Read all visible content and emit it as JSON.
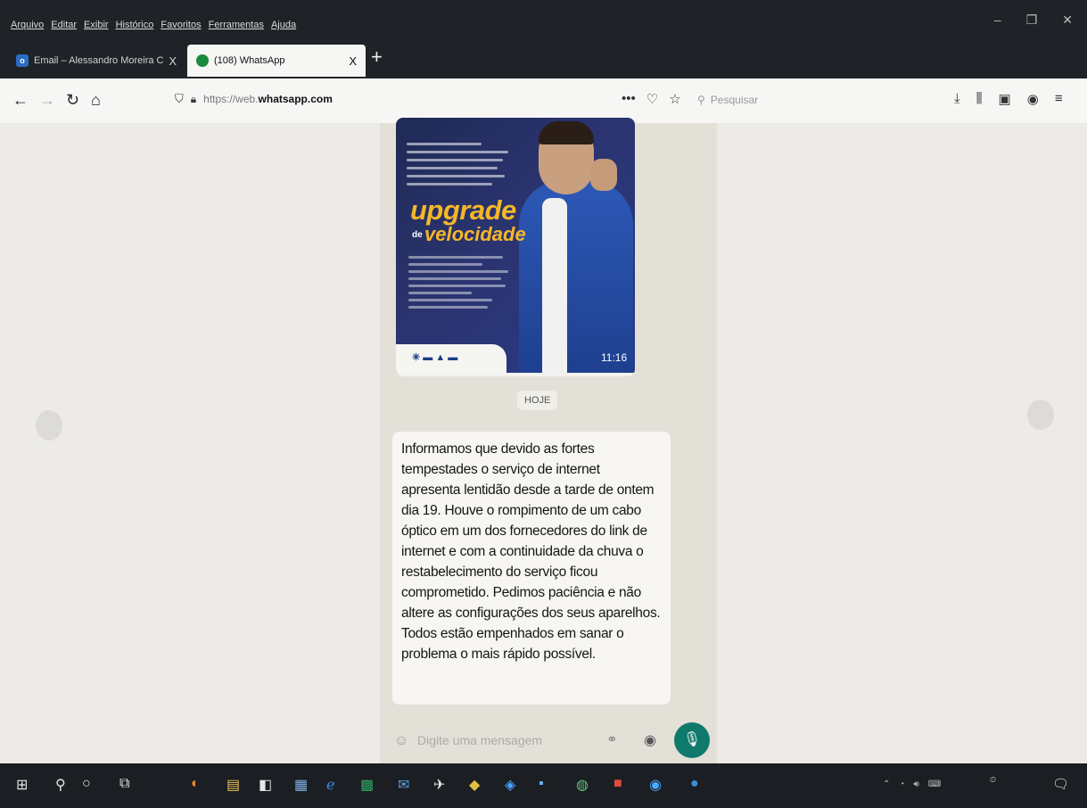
{
  "browser": {
    "menus": [
      "Arquivo",
      "Editar",
      "Exibir",
      "Histórico",
      "Favoritos",
      "Ferramentas",
      "Ajuda"
    ],
    "tabs": [
      {
        "label": "Email – Alessandro Moreira C...",
        "favicon_letter": "o"
      },
      {
        "label": "(108) WhatsApp"
      }
    ],
    "url_prefix": "https://web.",
    "url_domain": "whatsapp.com",
    "search_placeholder": "Pesquisar",
    "tab_close_glyph": "X",
    "new_tab_glyph": "+"
  },
  "chat": {
    "image_message": {
      "promo_title": "upgrade",
      "promo_de": "de",
      "promo_subtitle": "velocidade",
      "time": "11:16"
    },
    "date_divider": "HOJE",
    "text_message": {
      "body": "Informamos que devido as fortes tempestades o serviço de internet apresenta lentidão desde a tarde de ontem dia 19. Houve o rompimento de um cabo óptico em um dos fornecedores do link de internet e com a continuidade da chuva o restabelecimento do serviço ficou comprometido. Pedimos paciência e não altere as configurações dos seus aparelhos. Todos estão empenhados em sanar o problema o mais rápido possível."
    },
    "composer_placeholder": "Digite uma mensagem"
  },
  "colors": {
    "whatsapp_green": "#0f7a6c",
    "promo_yellow": "#f5b728",
    "promo_blue": "#2b3470"
  },
  "icons": {
    "nav": [
      "back-arrow-icon",
      "forward-arrow-icon",
      "reload-icon",
      "home-icon"
    ],
    "composer": [
      "emoji-icon",
      "paperclip-icon",
      "camera-icon",
      "microphone-icon"
    ]
  }
}
